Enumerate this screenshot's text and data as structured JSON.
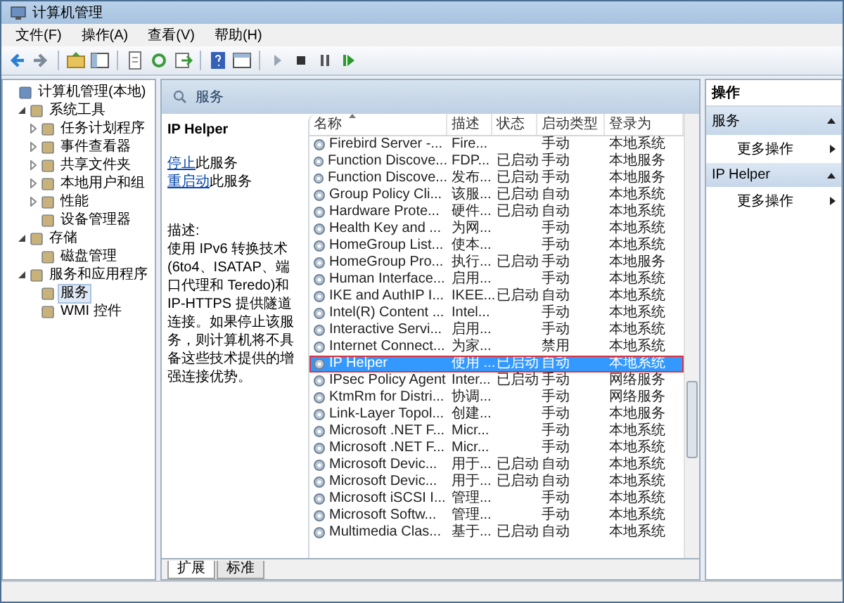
{
  "window": {
    "title": "计算机管理"
  },
  "menu": [
    "文件(F)",
    "操作(A)",
    "查看(V)",
    "帮助(H)"
  ],
  "tree": [
    {
      "label": "计算机管理(本地)",
      "kind": "root",
      "selected": false,
      "children": [
        {
          "label": "系统工具",
          "kind": "branch",
          "expanded": true,
          "selected": false,
          "children": [
            {
              "label": "任务计划程序",
              "kind": "branch",
              "expanded": false,
              "selected": false
            },
            {
              "label": "事件查看器",
              "kind": "branch",
              "expanded": false,
              "selected": false
            },
            {
              "label": "共享文件夹",
              "kind": "branch",
              "expanded": false,
              "selected": false
            },
            {
              "label": "本地用户和组",
              "kind": "branch",
              "expanded": false,
              "selected": false
            },
            {
              "label": "性能",
              "kind": "branch",
              "expanded": false,
              "selected": false
            },
            {
              "label": "设备管理器",
              "kind": "leaf",
              "selected": false
            }
          ]
        },
        {
          "label": "存储",
          "kind": "branch",
          "expanded": true,
          "selected": false,
          "children": [
            {
              "label": "磁盘管理",
              "kind": "leaf",
              "selected": false
            }
          ]
        },
        {
          "label": "服务和应用程序",
          "kind": "branch",
          "expanded": true,
          "selected": false,
          "children": [
            {
              "label": "服务",
              "kind": "leaf",
              "selected": true
            },
            {
              "label": "WMI 控件",
              "kind": "leaf",
              "selected": false
            }
          ]
        }
      ]
    }
  ],
  "center": {
    "title": "服务",
    "detail": {
      "service_name": "IP Helper",
      "links": [
        {
          "link": "停止",
          "rest": "此服务"
        },
        {
          "link": "重启动",
          "rest": "此服务"
        }
      ],
      "description_label": "描述:",
      "description": "使用 IPv6 转换技术(6to4、ISATAP、端口代理和 Teredo)和 IP-HTTPS 提供隧道连接。如果停止该服务，则计算机将不具备这些技术提供的增强连接优势。"
    },
    "table": {
      "columns": [
        {
          "label": "名称",
          "sorted": true
        },
        {
          "label": "描述",
          "sorted": false
        },
        {
          "label": "状态",
          "sorted": false
        },
        {
          "label": "启动类型",
          "sorted": false
        },
        {
          "label": "登录为",
          "sorted": false
        }
      ],
      "rows": [
        {
          "cells": [
            "Firebird Server -...",
            "Fire...",
            "",
            "手动",
            "本地系统"
          ],
          "selected": false
        },
        {
          "cells": [
            "Function Discove...",
            "FDP...",
            "已启动",
            "手动",
            "本地服务"
          ],
          "selected": false
        },
        {
          "cells": [
            "Function Discove...",
            "发布...",
            "已启动",
            "手动",
            "本地服务"
          ],
          "selected": false
        },
        {
          "cells": [
            "Group Policy Cli...",
            "该服...",
            "已启动",
            "自动",
            "本地系统"
          ],
          "selected": false
        },
        {
          "cells": [
            "Hardware Prote...",
            "硬件...",
            "已启动",
            "自动",
            "本地系统"
          ],
          "selected": false
        },
        {
          "cells": [
            "Health Key and ...",
            "为网...",
            "",
            "手动",
            "本地系统"
          ],
          "selected": false
        },
        {
          "cells": [
            "HomeGroup List...",
            "使本...",
            "",
            "手动",
            "本地系统"
          ],
          "selected": false
        },
        {
          "cells": [
            "HomeGroup Pro...",
            "执行...",
            "已启动",
            "手动",
            "本地服务"
          ],
          "selected": false
        },
        {
          "cells": [
            "Human Interface...",
            "启用...",
            "",
            "手动",
            "本地系统"
          ],
          "selected": false
        },
        {
          "cells": [
            "IKE and AuthIP I...",
            "IKEE...",
            "已启动",
            "自动",
            "本地系统"
          ],
          "selected": false
        },
        {
          "cells": [
            "Intel(R) Content ...",
            "Intel...",
            "",
            "手动",
            "本地系统"
          ],
          "selected": false
        },
        {
          "cells": [
            "Interactive Servi...",
            "启用...",
            "",
            "手动",
            "本地系统"
          ],
          "selected": false
        },
        {
          "cells": [
            "Internet Connect...",
            "为家...",
            "",
            "禁用",
            "本地系统"
          ],
          "selected": false
        },
        {
          "cells": [
            "IP Helper",
            "使用 ...",
            "已启动",
            "自动",
            "本地系统"
          ],
          "selected": true
        },
        {
          "cells": [
            "IPsec Policy Agent",
            "Inter...",
            "已启动",
            "手动",
            "网络服务"
          ],
          "selected": false
        },
        {
          "cells": [
            "KtmRm for Distri...",
            "协调...",
            "",
            "手动",
            "网络服务"
          ],
          "selected": false
        },
        {
          "cells": [
            "Link-Layer Topol...",
            "创建...",
            "",
            "手动",
            "本地服务"
          ],
          "selected": false
        },
        {
          "cells": [
            "Microsoft .NET F...",
            "Micr...",
            "",
            "手动",
            "本地系统"
          ],
          "selected": false
        },
        {
          "cells": [
            "Microsoft .NET F...",
            "Micr...",
            "",
            "手动",
            "本地系统"
          ],
          "selected": false
        },
        {
          "cells": [
            "Microsoft Devic...",
            "用于...",
            "已启动",
            "自动",
            "本地系统"
          ],
          "selected": false
        },
        {
          "cells": [
            "Microsoft Devic...",
            "用于...",
            "已启动",
            "自动",
            "本地系统"
          ],
          "selected": false
        },
        {
          "cells": [
            "Microsoft iSCSI I...",
            "管理...",
            "",
            "手动",
            "本地系统"
          ],
          "selected": false
        },
        {
          "cells": [
            "Microsoft Softw...",
            "管理...",
            "",
            "手动",
            "本地系统"
          ],
          "selected": false
        },
        {
          "cells": [
            "Multimedia Clas...",
            "基于...",
            "已启动",
            "自动",
            "本地系统"
          ],
          "selected": false
        }
      ]
    },
    "tabs": [
      {
        "label": "扩展",
        "selected": true
      },
      {
        "label": "标准",
        "selected": false
      }
    ]
  },
  "actions": {
    "title": "操作",
    "sections": [
      {
        "title": "服务",
        "expanded": true,
        "items": [
          "更多操作"
        ]
      },
      {
        "title": "IP Helper",
        "expanded": true,
        "items": [
          "更多操作"
        ]
      }
    ]
  }
}
